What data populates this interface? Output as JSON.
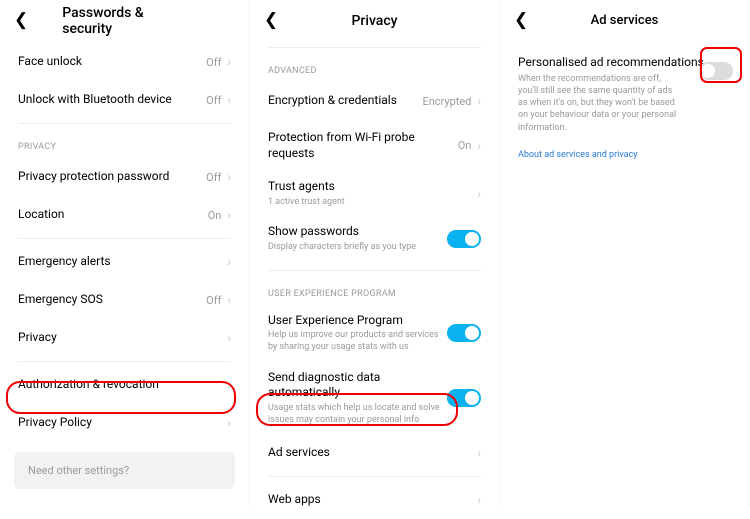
{
  "screen1": {
    "title": "Passwords & security",
    "rows": {
      "face_unlock": {
        "label": "Face unlock",
        "value": "Off"
      },
      "unlock_bt": {
        "label": "Unlock with Bluetooth device",
        "value": "Off"
      }
    },
    "privacy_header": "PRIVACY",
    "privacy_rows": {
      "ppp": {
        "label": "Privacy protection password",
        "value": "Off"
      },
      "location": {
        "label": "Location",
        "value": "On"
      }
    },
    "more_rows": {
      "emergency_alerts": {
        "label": "Emergency alerts"
      },
      "emergency_sos": {
        "label": "Emergency SOS",
        "value": "Off"
      },
      "privacy": {
        "label": "Privacy"
      }
    },
    "bottom_rows": {
      "auth": {
        "label": "Authorization & revocation"
      },
      "policy": {
        "label": "Privacy Policy"
      }
    },
    "footer": "Need other settings?"
  },
  "screen2": {
    "title": "Privacy",
    "advanced_header": "ADVANCED",
    "advanced_rows": {
      "encryption": {
        "label": "Encryption & credentials",
        "value": "Encrypted"
      },
      "wifi_probe": {
        "label": "Protection from Wi-Fi probe requests",
        "value": "On"
      },
      "trust_agents": {
        "label": "Trust agents",
        "sub": "1 active trust agent"
      },
      "show_passwords": {
        "label": "Show passwords",
        "sub": "Display characters briefly as you type"
      }
    },
    "uep_header": "USER EXPERIENCE PROGRAM",
    "uep_rows": {
      "uep": {
        "label": "User Experience Program",
        "sub": "Help us improve our products and services by sharing your usage stats with us"
      },
      "diag": {
        "label": "Send diagnostic data automatically",
        "sub": "Usage stats which help us locate and solve issues may contain your personal info"
      },
      "ad_services": {
        "label": "Ad services"
      },
      "web_apps": {
        "label": "Web apps"
      }
    }
  },
  "screen3": {
    "title": "Ad services",
    "personalised": {
      "title": "Personalised ad recommendations",
      "desc": "When the recommendations are off, you'll still see the same quantity of ads as when it's on, but they won't be based on your behaviour data or your personal information."
    },
    "link": "About ad services and privacy"
  }
}
